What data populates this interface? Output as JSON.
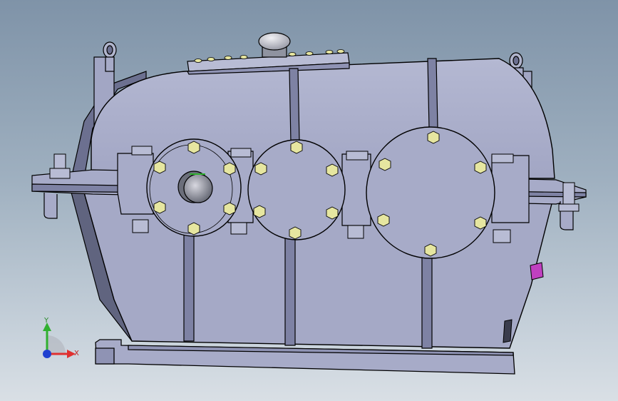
{
  "viewport": {
    "background_top": "#7f93a8",
    "background_bottom": "#d9dfe5",
    "model": {
      "part_color": "#a7abc8",
      "part_shade": "#8f93b4",
      "edge_color": "#000000",
      "bolt_color": "#e6e6a0",
      "accent_color": "#c040c0",
      "shaft_color": "#6b6e7a"
    },
    "triad": {
      "x_label": "X",
      "y_label": "Y",
      "x_color": "#e03030",
      "y_color": "#30b030",
      "z_color": "#2040d0"
    }
  }
}
